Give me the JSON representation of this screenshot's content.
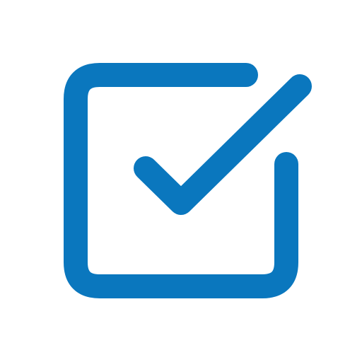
{
  "icon": {
    "name": "checkbox-checked-icon",
    "color": "#0A77BE",
    "background": "#FFFFFF"
  }
}
